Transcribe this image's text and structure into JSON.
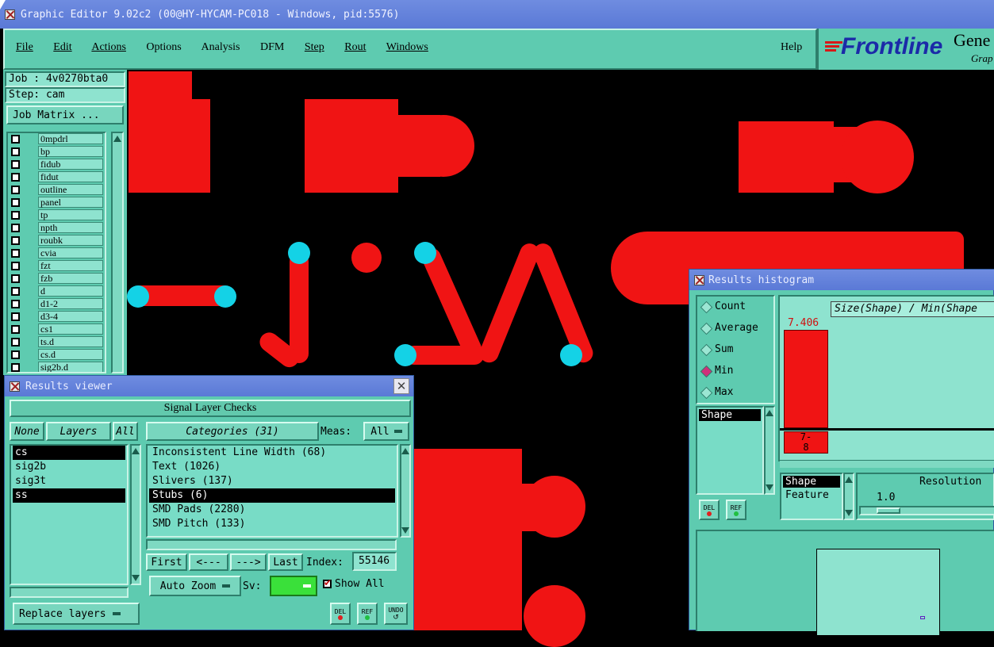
{
  "app": {
    "title": "Graphic Editor 9.02c2 (00@HY-HYCAM-PC018 - Windows, pid:5576)"
  },
  "menu": {
    "items": [
      "File",
      "Edit",
      "Actions",
      "Options",
      "Analysis",
      "DFM",
      "Step",
      "Rout",
      "Windows"
    ],
    "help": "Help"
  },
  "brand": {
    "logo": "Frontline",
    "product": "Gene",
    "sub": "Grap"
  },
  "job": {
    "job_line": "Job : 4v0270bta0",
    "step_line": "Step: cam",
    "matrix_button": "Job Matrix ..."
  },
  "layers": [
    "0mpdrl",
    "bp",
    "fidub",
    "fidut",
    "outline",
    "panel",
    "tp",
    "npth",
    "roubk",
    "cvia",
    "fzt",
    "fzb",
    "d",
    "d1-2",
    "d3-4",
    "cs1",
    "ts.d",
    "cs.d",
    "sig2b.d"
  ],
  "results_viewer": {
    "title": "Results viewer",
    "header": "Signal Layer Checks",
    "none_btn": "None",
    "layers_btn": "Layers",
    "all_btn": "All",
    "layer_list": [
      "cs",
      "sig2b",
      "sig3t",
      "ss"
    ],
    "categories_btn": "Categories (31)",
    "meas_label": "Meas:",
    "meas_value": "All",
    "categories": [
      "Inconsistent Line Width (68)",
      "Text (1026)",
      "Slivers (137)",
      "Stubs (6)",
      "SMD Pads (2280)",
      "SMD Pitch (133)"
    ],
    "nav": {
      "first": "First",
      "prev": "<---",
      "next": "--->",
      "last": "Last",
      "index_label": "Index:",
      "index_value": "55146"
    },
    "auto_zoom": "Auto Zoom",
    "sv_label": "Sv:",
    "show_all": "Show All",
    "replace_layers": "Replace layers",
    "del": "DEL",
    "ref": "REF",
    "undo": "UNDO"
  },
  "histogram": {
    "title": "Results histogram",
    "modes": [
      "Count",
      "Average",
      "Sum",
      "Min",
      "Max"
    ],
    "selected_mode": "Min",
    "list_item": "Shape",
    "chart_title": "Size(Shape) / Min(Shape",
    "bar_value": "7.406",
    "bucket_label": "7-\n8",
    "group_items": [
      "Shape",
      "Feature"
    ],
    "resolution_label": "Resolution",
    "resolution_value": "1.0",
    "del": "DEL",
    "ref": "REF"
  },
  "colors": {
    "pad": "#f01414",
    "highlight": "#14d2e6",
    "panel": "#5ecbb0",
    "titlebar": "#5a79d6"
  }
}
